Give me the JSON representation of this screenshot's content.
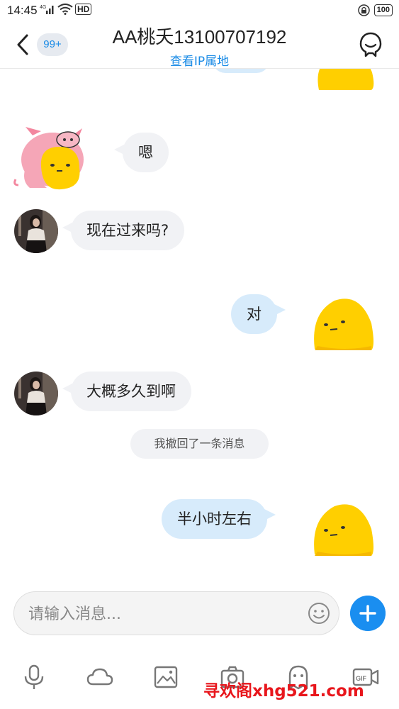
{
  "status_bar": {
    "time": "14:45",
    "network_label": "4G",
    "hd_label": "HD",
    "battery": "100"
  },
  "header": {
    "badge": "99+",
    "title": "AA桃夭13100707192",
    "subtitle": "查看IP属地"
  },
  "messages": [
    {
      "direction": "in",
      "text": "嗯",
      "avatar": "pig-hood-emoji"
    },
    {
      "direction": "in",
      "text": "现在过来吗?",
      "avatar": "woman-photo"
    },
    {
      "direction": "out",
      "text": "对",
      "avatar": "yellow-blob"
    },
    {
      "direction": "in",
      "text": "大概多久到啊",
      "avatar": "woman-photo"
    },
    {
      "direction": "system",
      "text": "我撤回了一条消息"
    },
    {
      "direction": "out",
      "text": "半小时左右",
      "avatar": "yellow-blob"
    }
  ],
  "input": {
    "placeholder": "请输入消息..."
  },
  "toolbar": {
    "items": [
      "microphone-icon",
      "cloud-icon",
      "image-icon",
      "camera-icon",
      "ghost-icon",
      "gif-video-icon"
    ]
  },
  "watermark": "寻欢阁xhg521.com",
  "colors": {
    "accent": "#1a8be6",
    "outgoing_bubble": "#d7ebfb",
    "incoming_bubble": "#f1f2f5",
    "watermark": "#e8161c"
  }
}
